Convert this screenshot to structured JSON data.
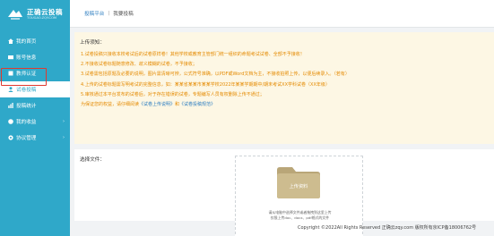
{
  "brand": {
    "title": "正确云投稿",
    "subtitle": "TOUGAO.ZQY.COM"
  },
  "sidebar": {
    "items": [
      {
        "label": "我的首页",
        "icon": "home-icon"
      },
      {
        "label": "账号信息",
        "icon": "id-card-icon"
      },
      {
        "label": "教师认证",
        "icon": "certificate-icon"
      },
      {
        "label": "试卷投稿",
        "icon": "user-icon",
        "active": true
      },
      {
        "label": "投稿统计",
        "icon": "chart-icon"
      },
      {
        "label": "我的收益",
        "icon": "yen-icon",
        "arrow": "›"
      },
      {
        "label": "协议管理",
        "icon": "gear-icon",
        "arrow": "›"
      }
    ]
  },
  "breadcrumb": {
    "root": "投稿平台",
    "separator": "|",
    "current": "我要投稿"
  },
  "notice": {
    "title": "上传须知：",
    "lines": [
      "1.试卷投稿只接收本校考试后的试卷原样卷！其他学校或教育主管部门统一组织的命题考试试卷、全部不予接收！",
      "2.不接收试卷标题随意修改、歧义模糊的试卷，不予接收；",
      "3.试卷需包括原题及必要的说明，图片需清晰可辨，公式符号准确，以PDF或Word文档为主，不接收拍照上传，以便后续录入。（若有）",
      "4.上传的试卷标题需写明考试的完整信息，如：某某省某某市某某学校2022年某某学期期中/期末考试XX学科试卷（XX年级）",
      "5.审核通过本平台发布的试卷后，对于存在错误的试卷，专题编写人员有权删除上传不通过；"
    ],
    "footer_text": "为保证您的权益，请仔细阅读",
    "link1": "《试卷上传说明》",
    "and_text": "和",
    "link2": "《试卷投稿规范》"
  },
  "upload": {
    "label": "选择文件：",
    "button_label": "上传资料",
    "hint_line1": "请从电脑中选择文件或者拖拽到这里上传",
    "hint_line2": "仅限上传doc、docx、pdf格式的文件"
  },
  "footer": {
    "copyright": "Copyright ©2022All Rights Reserved 正确云zqy.com 版权所有京ICP备18006762号"
  },
  "colors": {
    "sidebar": "#2fa8c9",
    "notice_bg": "#fdf7e4",
    "notice_text": "#e48a00",
    "link": "#2f7fc1",
    "folder": "#c9b88a",
    "highlight": "#e0392f"
  }
}
